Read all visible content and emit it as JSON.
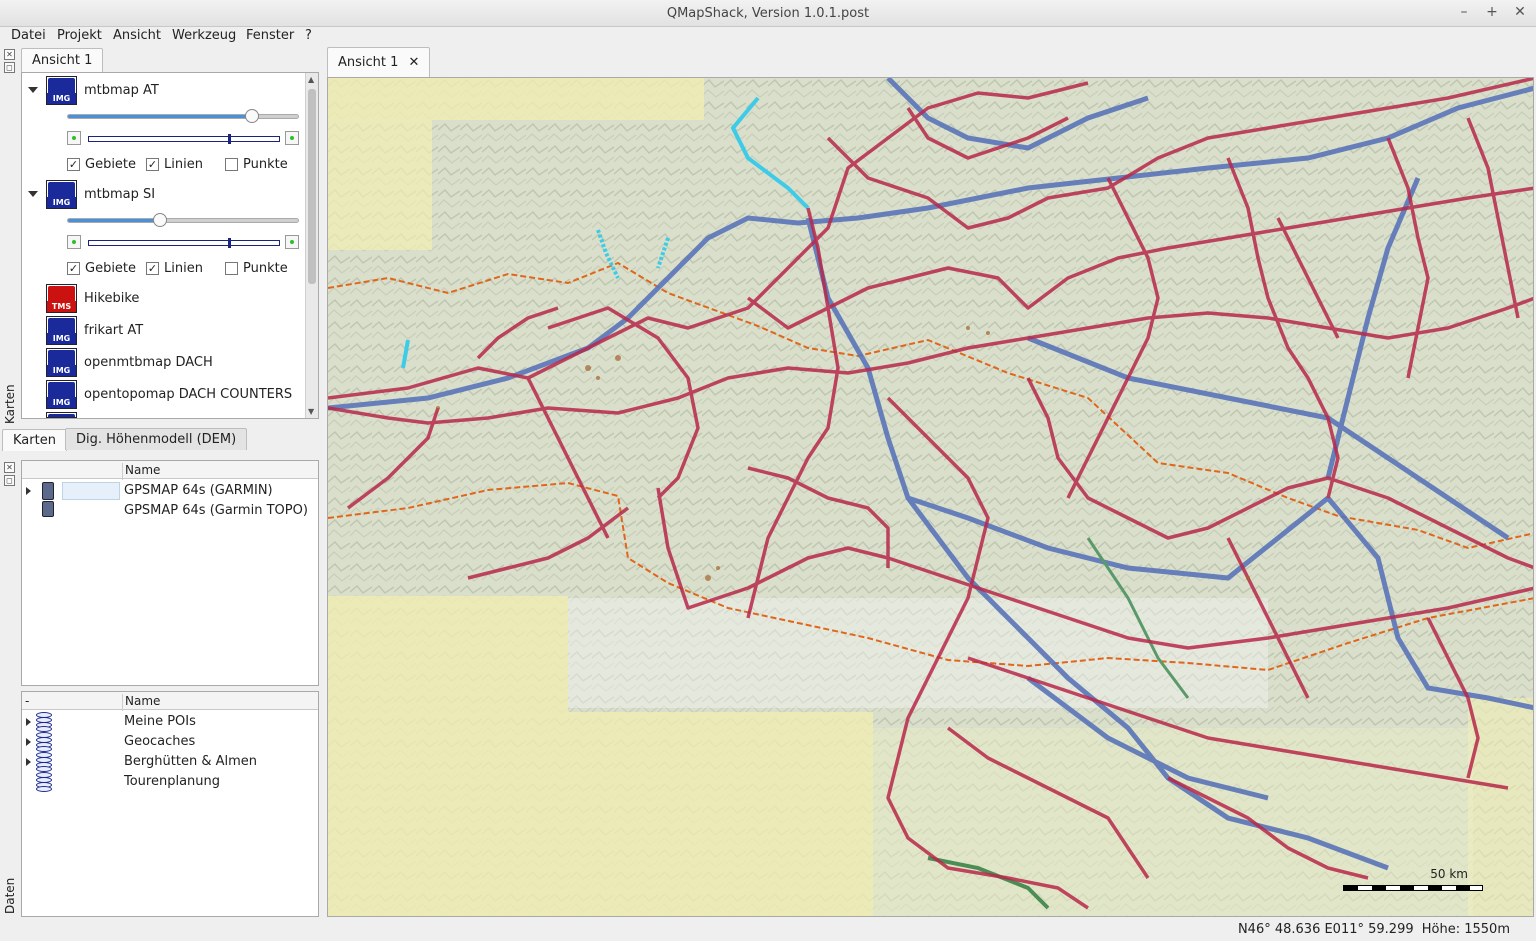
{
  "window": {
    "title": "QMapShack, Version 1.0.1.post",
    "buttons": [
      "–",
      "+",
      "✕"
    ]
  },
  "menu": [
    "Datei",
    "Projekt",
    "Ansicht",
    "Werkzeug",
    "Fenster",
    "?"
  ],
  "left_dock": {
    "tab_top": "Ansicht 1",
    "maps": [
      {
        "name": "mtbmap AT",
        "icon": "IMG",
        "expanded": true,
        "opacity_percent": 80,
        "layers": {
          "areas": "Gebiete",
          "lines": "Linien",
          "points": "Punkte",
          "areas_on": true,
          "lines_on": true,
          "points_on": false
        }
      },
      {
        "name": "mtbmap SI",
        "icon": "IMG",
        "expanded": true,
        "opacity_percent": 40,
        "layers": {
          "areas": "Gebiete",
          "lines": "Linien",
          "points": "Punkte",
          "areas_on": true,
          "lines_on": true,
          "points_on": false
        }
      },
      {
        "name": "Hikebike",
        "icon": "TMS"
      },
      {
        "name": "frikart AT",
        "icon": "IMG"
      },
      {
        "name": "openmtbmap DACH",
        "icon": "IMG"
      },
      {
        "name": "opentopomap DACH COUNTERS",
        "icon": "IMG"
      }
    ],
    "bottom_tabs": [
      "Karten",
      "Dig. Höhenmodell (DEM)"
    ],
    "dock_label_maps": "Karten",
    "dock_label_data": "Daten"
  },
  "devices": {
    "header": "Name",
    "rows": [
      "GPSMAP 64s (GARMIN)",
      "GPSMAP 64s (Garmin TOPO)"
    ]
  },
  "databases": {
    "header_col0": "-",
    "header": "Name",
    "rows": [
      "Meine POIs",
      "Geocaches",
      "Berghütten & Almen",
      "Tourenplanung"
    ]
  },
  "main_tab": {
    "label": "Ansicht 1",
    "close": "✕"
  },
  "map": {
    "scale_label": "50 km"
  },
  "status": {
    "coords": "N46° 48.636 E011° 59.299",
    "elevation": "Höhe: 1550m"
  },
  "colors": {
    "road_red": "#b8284a",
    "road_blue": "#5a74b8",
    "river_cyan": "#3ecbe8",
    "border_orange": "#e0661c",
    "land_yellow": "#f2efb2"
  }
}
